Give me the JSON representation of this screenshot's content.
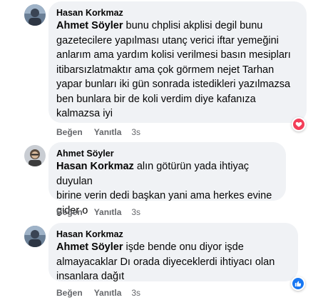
{
  "comments": [
    {
      "author": "Hasan Korkmaz",
      "mention": "Ahmet Söyler",
      "lines": [
        " bunu chplisi akplisi degil bunu",
        "gazetecilere yapılması utanç verici iftar yemeğini",
        "anlarım ama yardım kolisi verilmesi basın mesipları",
        "itibarsızlatmaktır ama çok görmem nejet Tarhan",
        "yapar bunları iki gün sonrada istedikleri yazılmazsa",
        "ben bunlara bir de koli verdim diye kafanıza",
        "kalmazsa iyi"
      ],
      "like_label": "Beğen",
      "reply_label": "Yanıtla",
      "time": "3s",
      "reaction": "love-reaction",
      "reaction_color": "#f33e58"
    },
    {
      "author": "Ahmet Söyler",
      "mention": "Hasan Korkmaz",
      "lines": [
        " alın götürün yada ihtiyaç duyulan",
        "birine verin dedi başkan yani ama herkes evine",
        "gider o"
      ],
      "like_label": "Beğen",
      "reply_label": "Yanıtla",
      "time": "3s"
    },
    {
      "author": "Hasan Korkmaz",
      "mention": "Ahmet Söyler",
      "lines": [
        " işde bende onu diyor işde",
        "almayacaklar Dı orada diyeceklerdi ihtiyacı olan",
        "insanlara dağıt"
      ],
      "like_label": "Beğen",
      "reply_label": "Yanıtla",
      "time": "3s",
      "reaction": "like-reaction",
      "reaction_color": "#1877f2"
    }
  ]
}
